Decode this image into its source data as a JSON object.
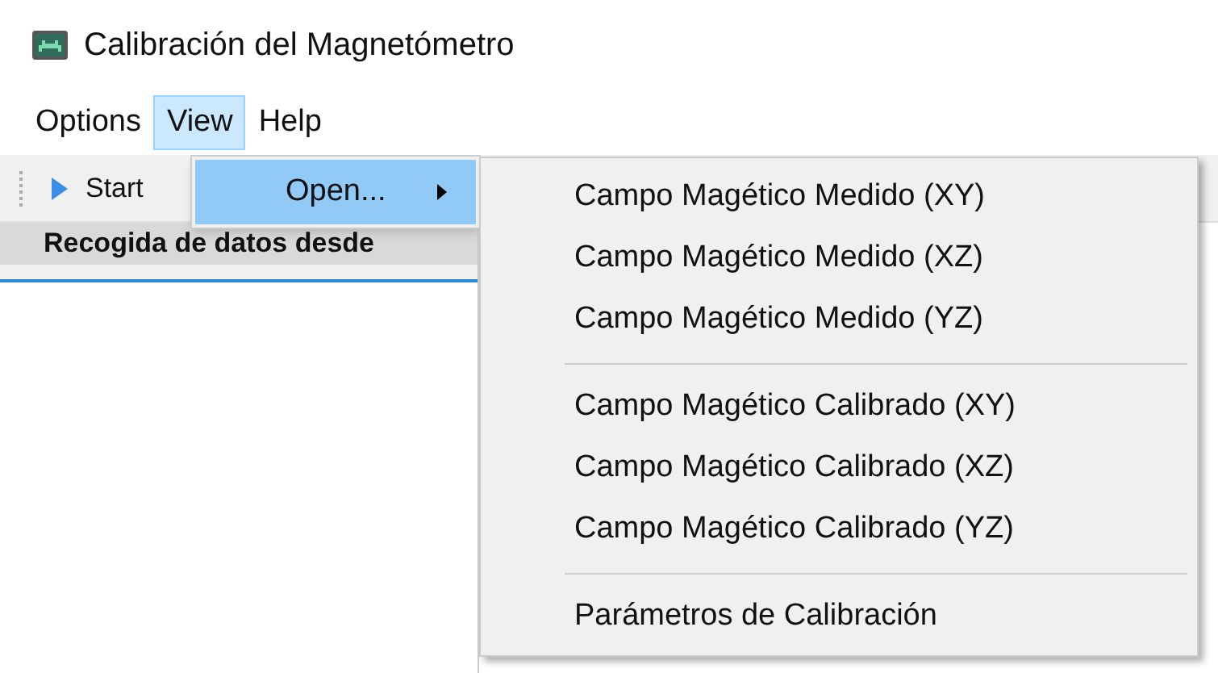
{
  "window": {
    "title": "Calibración del Magnetómetro"
  },
  "menubar": [
    {
      "label": "Options",
      "selected": false
    },
    {
      "label": "View",
      "selected": true
    },
    {
      "label": "Help",
      "selected": false
    }
  ],
  "toolbar": [
    {
      "label": "Start"
    }
  ],
  "panel": {
    "header": "Recogida de datos desde"
  },
  "view_menu": {
    "items": [
      {
        "label": "Open...",
        "highlighted": true,
        "has_submenu": true
      }
    ]
  },
  "submenu": {
    "items": [
      {
        "kind": "item",
        "label": "Campo Magético Medido (XY)"
      },
      {
        "kind": "item",
        "label": "Campo Magético Medido (XZ)"
      },
      {
        "kind": "item",
        "label": "Campo Magético Medido (YZ)"
      },
      {
        "kind": "separator"
      },
      {
        "kind": "item",
        "label": "Campo Magético Calibrado (XY)"
      },
      {
        "kind": "item",
        "label": "Campo Magético Calibrado (XZ)"
      },
      {
        "kind": "item",
        "label": "Campo Magético Calibrado (YZ)"
      },
      {
        "kind": "separator"
      },
      {
        "kind": "item",
        "label": "Parámetros de Calibración"
      }
    ]
  }
}
